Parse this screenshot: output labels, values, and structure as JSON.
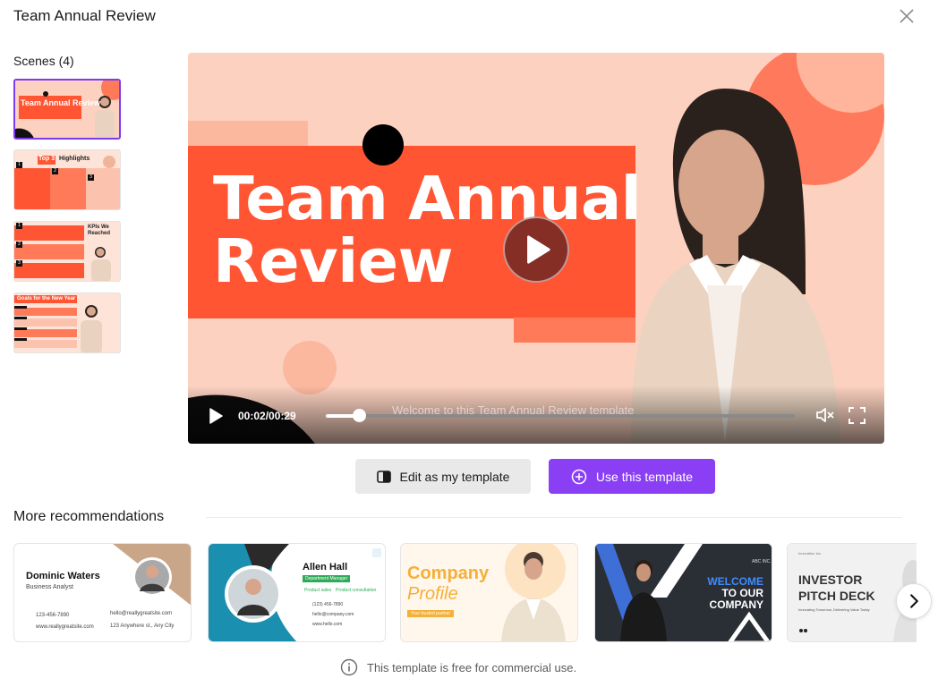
{
  "dialog": {
    "title": "Team Annual Review"
  },
  "scenes": {
    "label": "Scenes (4)",
    "items": [
      {
        "title": "Team Annual Review"
      },
      {
        "title_a": "Top 3",
        "title_b": "Highlights",
        "numbers": [
          "1",
          "2",
          "3"
        ]
      },
      {
        "title": "KPIs We Reached",
        "numbers": [
          "1",
          "2",
          "3"
        ]
      },
      {
        "title": "Goals for the New Year"
      }
    ]
  },
  "video": {
    "heading_line1": "Team Annual",
    "heading_line2": "Review",
    "time": "00:02/00:29",
    "subtitle": "Welcome to this Team Annual Review template",
    "progress": 0.07
  },
  "actions": {
    "edit_label": "Edit as my template",
    "use_label": "Use this template"
  },
  "recommendations": {
    "label": "More recommendations",
    "cards": [
      {
        "name": "Dominic Waters",
        "role": "Business Analyst",
        "phone": "123-456-7890",
        "email": "hello@reallygreatsite.com",
        "web": "www.reallygreatsite.com",
        "address": "123 Anywhere st., Any City"
      },
      {
        "name": "Allen Hall",
        "role": "Department Manager",
        "tag1": "Product sales",
        "tag2": "Product consultation",
        "phone": "(123) 456-7890",
        "email": "hello@company.com",
        "web": "www.hello.com"
      },
      {
        "line1": "Company",
        "line2": "Profile",
        "tagline": "Your trusted partner"
      },
      {
        "company": "ABC INC.",
        "line1": "WELCOME",
        "line2": "TO OUR",
        "line3": "COMPANY"
      },
      {
        "brand": "Innovation Inc.",
        "line1": "INVESTOR",
        "line2": "PITCH DECK",
        "sub": "Innovating Tomorrow, Delivering Value Today"
      }
    ]
  },
  "footer": {
    "note": "This template is free for commercial use."
  },
  "colors": {
    "accent": "#8a3ff5",
    "brand_orange": "#ff5533",
    "peach": "#fcd1c0"
  }
}
